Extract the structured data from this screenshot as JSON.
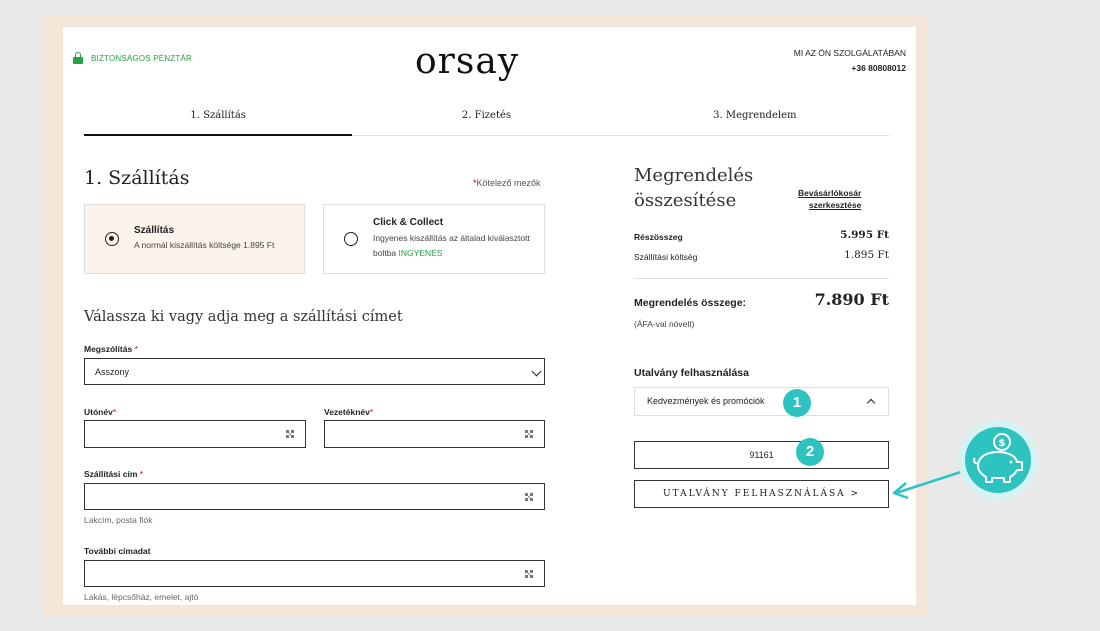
{
  "header": {
    "secure_label": "BIZTONSÁGOS PÉNZTÁR",
    "logo_text": "orsay",
    "service_label": "MI AZ ÖN SZOLGÁLATÁBAN",
    "service_phone": "+36 80808012"
  },
  "steps": [
    {
      "label": "1. Szállítás",
      "active": true
    },
    {
      "label": "2. Fizetés",
      "active": false
    },
    {
      "label": "3. Megrendelem",
      "active": false
    }
  ],
  "shipping": {
    "title": "1. Szállítás",
    "required_note": "Kötelező mezők",
    "options": [
      {
        "title": "Szállítás",
        "desc": "A normál kiszállítás költsége 1.895 Ft",
        "selected": true
      },
      {
        "title": "Click & Collect",
        "desc_line1": "Ingyenes kiszállítás az általad kiválasztott",
        "desc_line2": "boltba",
        "free_label": "INGYENES",
        "selected": false
      }
    ]
  },
  "address": {
    "title": "Válassza ki vagy adja meg a szállítási címet",
    "salutation_label": "Megszólítás",
    "salutation_value": "Asszony",
    "firstname_label": "Utónév",
    "lastname_label": "Vezetéknév",
    "street_label": "Szállítási cím",
    "street_hint": "Lakcím, posta fiók",
    "extra_label": "További címadat",
    "extra_hint": "Lakás, lépcsőház, emelet, ajtó"
  },
  "summary": {
    "title_line1": "Megrendelés",
    "title_line2": "összesítése",
    "edit_line1": "Bevásárlókosár",
    "edit_line2": "szerkesztése",
    "subtotal_label": "Részösszeg",
    "subtotal_value": "5.995 Ft",
    "shipping_label": "Szállítási költség",
    "shipping_value": "1.895 Ft",
    "total_label": "Megrendelés összege:",
    "total_value": "7.890 Ft",
    "vat_note": "(ÁFA-val növelt)"
  },
  "voucher": {
    "title": "Utalvány felhasználása",
    "dropdown_label": "Kedvezmények és promóciók",
    "code_value": "91161",
    "apply_button": "UTALVÁNY FELHASZNÁLÁSA >"
  },
  "annotations": {
    "badge1": "1",
    "badge2": "2"
  },
  "colors": {
    "accent_green": "#27a046",
    "accent_teal": "#2cc3c0",
    "required_red": "#d0021b",
    "selected_option_bg": "#fcf3ed",
    "frame_beige": "#f3e6d8"
  }
}
